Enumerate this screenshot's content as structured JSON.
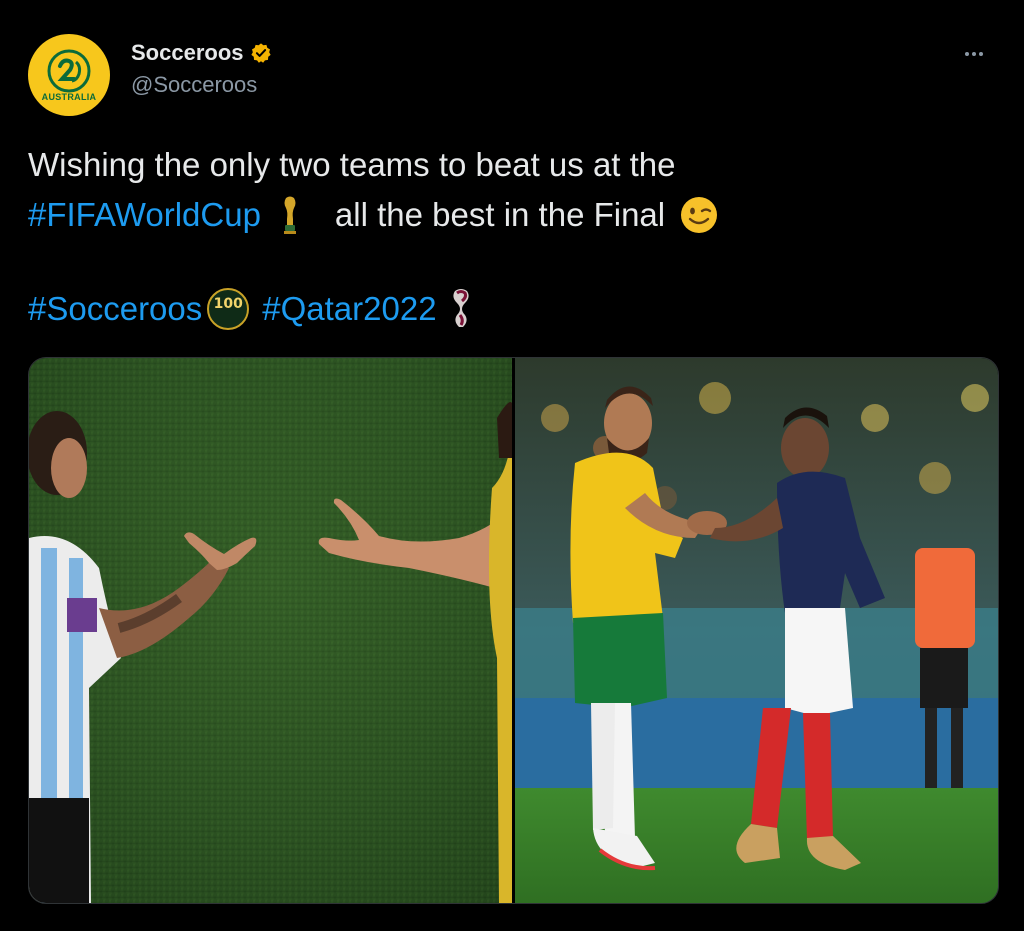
{
  "tweet": {
    "author": {
      "display_name": "Socceroos",
      "handle": "@Socceroos",
      "avatar_text": "AUSTRALIA",
      "verified_icon": "verified-badge-icon",
      "verified_color": "#f5b301"
    },
    "more_icon": "more-horizontal-icon",
    "text": {
      "line1": "Wishing the only two teams to beat us at the",
      "line2_hashtag": "#FIFAWorldCup",
      "line2_rest": "all the best in the Final",
      "line3_hashtag1": "#Socceroos",
      "line3_hashtag2": "#Qatar2022",
      "badge_100": "100"
    },
    "icons": {
      "trophy": "world-cup-trophy-icon",
      "wink": "winking-face-emoji-icon",
      "socceroos_100": "socceroos-100-badge-icon",
      "qatar_emblem": "qatar-2022-emblem-icon"
    },
    "media": {
      "left_image": "handshake-photo-argentina-australia",
      "right_image": "handshake-photo-australia-france"
    }
  },
  "colors": {
    "background": "#000000",
    "text": "#e7e9ea",
    "secondary_text": "#8b98a5",
    "hashtag": "#1d9bf0",
    "avatar_bg": "#f7c71c"
  }
}
